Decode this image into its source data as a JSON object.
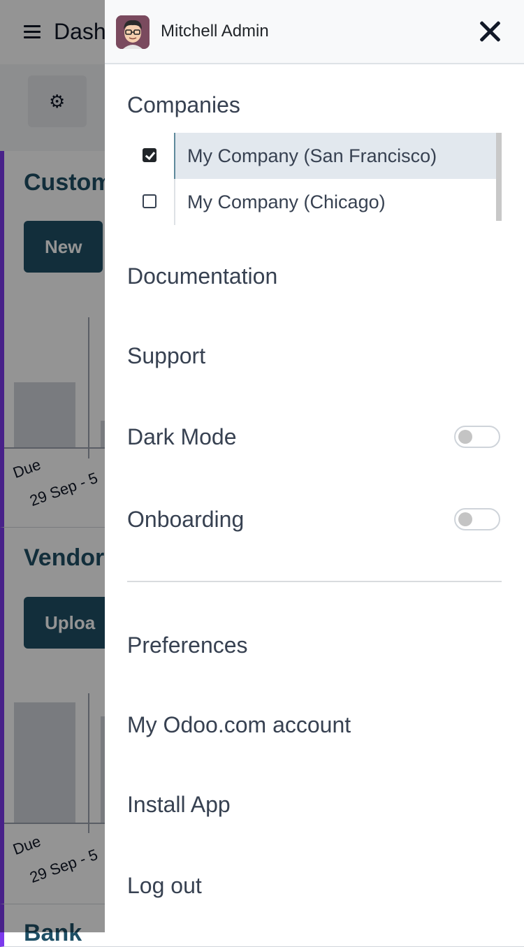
{
  "background": {
    "title": "Dash",
    "cards": [
      {
        "title": "Custom",
        "button_label": "New",
        "axis_labels": [
          "Due",
          "29 Sep - 5"
        ]
      },
      {
        "title": "Vendor",
        "button_label": "Uploa",
        "axis_labels": [
          "Due",
          "29 Sep - 5"
        ]
      },
      {
        "title": "Bank"
      }
    ]
  },
  "drawer": {
    "user_name": "Mitchell Admin",
    "companies_title": "Companies",
    "companies": [
      {
        "name": "My Company (San Francisco)",
        "checked": true
      },
      {
        "name": "My Company (Chicago)",
        "checked": false
      }
    ],
    "menu": {
      "documentation": "Documentation",
      "support": "Support",
      "dark_mode": "Dark Mode",
      "onboarding": "Onboarding",
      "preferences": "Preferences",
      "odoo_account": "My Odoo.com account",
      "install_app": "Install App",
      "logout": "Log out"
    },
    "toggles": {
      "dark_mode": false,
      "onboarding": false
    }
  },
  "colors": {
    "accent": "#1f5066",
    "selected_row": "#e2e8ee",
    "card_border": "#7c3aed"
  },
  "icons": [
    "hamburger-icon",
    "gear-icon",
    "avatar",
    "close-icon",
    "checkbox-icon",
    "toggle"
  ]
}
